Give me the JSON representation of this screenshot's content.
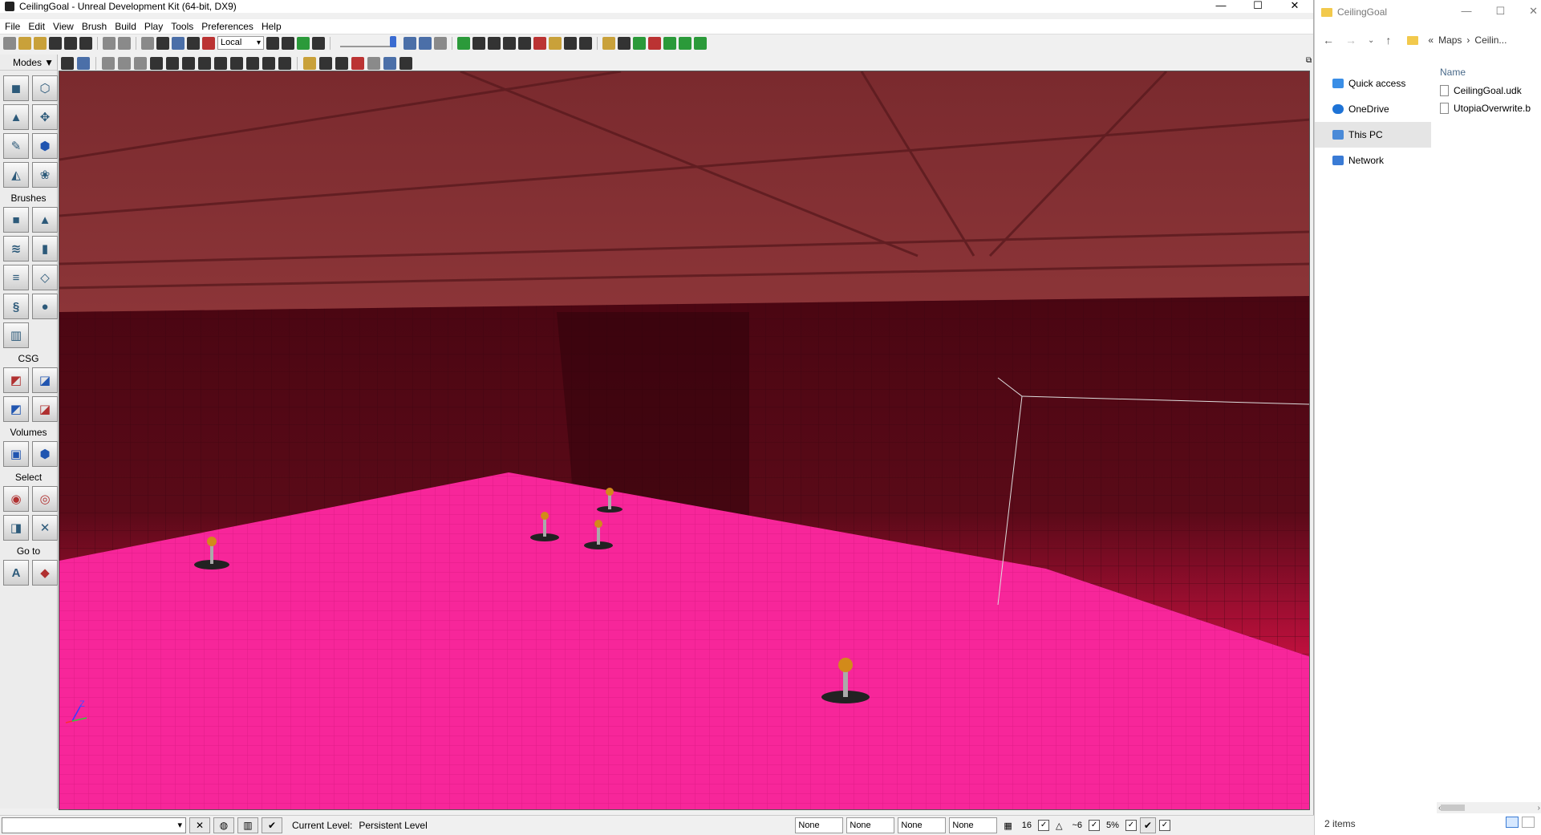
{
  "udk": {
    "title": "CeilingGoal - Unreal Development Kit (64-bit, DX9)",
    "window_controls": [
      "—",
      "☐",
      "✕"
    ],
    "menu": [
      "File",
      "Edit",
      "View",
      "Brush",
      "Build",
      "Play",
      "Tools",
      "Preferences",
      "Help"
    ],
    "coord_system": "Local",
    "modes_panel": {
      "title": "Modes",
      "sections": {
        "brushes": "Brushes",
        "csg": "CSG",
        "volumes": "Volumes",
        "select": "Select",
        "goto": "Go to"
      }
    },
    "status": {
      "current_level_label": "Current Level:",
      "current_level_value": "Persistent Level",
      "none_1": "None",
      "none_2": "None",
      "none_3": "None",
      "none_4": "None",
      "grid_size": "16",
      "rotation_snap": "~6",
      "scale_snap": "5%"
    },
    "viewport": {
      "axis_z": "Z",
      "axis_x": "x",
      "axis_y": "y"
    }
  },
  "explorer": {
    "title": "CeilingGoal",
    "window_controls": [
      "—",
      "☐",
      "✕"
    ],
    "path": [
      "«",
      "Maps",
      "›",
      "Ceilin..."
    ],
    "nav_items": [
      "Quick access",
      "OneDrive",
      "This PC",
      "Network"
    ],
    "column_header": "Name",
    "files": [
      "CeilingGoal.udk",
      "UtopiaOverwrite.b"
    ],
    "item_count": "2 items",
    "colors": {
      "quick_access": "#3a8ee6",
      "onedrive": "#1e73d6",
      "this_pc": "#4a8ad8",
      "network": "#3a7bd5"
    }
  }
}
